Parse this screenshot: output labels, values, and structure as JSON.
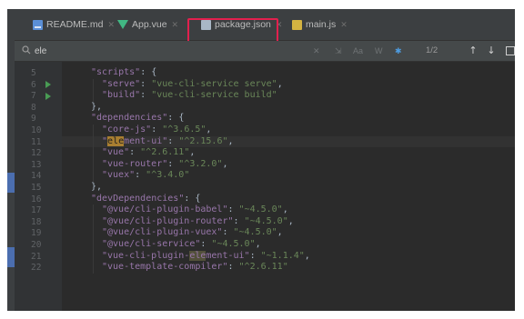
{
  "tabs": [
    {
      "label": "README.md",
      "icon": "markdown-file-icon"
    },
    {
      "label": "App.vue",
      "icon": "vue-file-icon"
    },
    {
      "label": "package.json",
      "icon": "json-file-icon",
      "active": true,
      "highlighted": true
    },
    {
      "label": "main.js",
      "icon": "js-file-icon"
    }
  ],
  "search": {
    "query": "ele",
    "match_count": "1/2"
  },
  "colors": {
    "key": "#9876aa",
    "string": "#6a8759",
    "punct": "#a9b7c6",
    "match_highlight": "#a97f31",
    "tab_highlight_frame": "#e2204e"
  },
  "editor": {
    "lines": [
      {
        "num": "5",
        "k": "\"scripts\"",
        "rest": ": {"
      },
      {
        "num": "6",
        "k": "\"serve\"",
        "sep": ": ",
        "v": "\"vue-cli-service serve\"",
        "end": ",",
        "run": true
      },
      {
        "num": "7",
        "k": "\"build\"",
        "sep": ": ",
        "v": "\"vue-cli-service build\"",
        "run": true
      },
      {
        "num": "8",
        "rest": "},"
      },
      {
        "num": "9",
        "k": "\"dependencies\"",
        "rest": ": {"
      },
      {
        "num": "10",
        "k": "\"core-js\"",
        "sep": ": ",
        "v": "\"^3.6.5\"",
        "end": ","
      },
      {
        "num": "11",
        "k_pre": "\"",
        "k_match": "ele",
        "k_post": "ment-ui\"",
        "sep": ": ",
        "v": "\"^2.15.6\"",
        "end": ","
      },
      {
        "num": "12",
        "k": "\"vue\"",
        "sep": ": ",
        "v": "\"^2.6.11\"",
        "end": ","
      },
      {
        "num": "13",
        "k": "\"vue-router\"",
        "sep": ": ",
        "v": "\"^3.2.0\"",
        "end": ","
      },
      {
        "num": "14",
        "k": "\"vuex\"",
        "sep": ": ",
        "v": "\"^3.4.0\""
      },
      {
        "num": "15",
        "rest": "},"
      },
      {
        "num": "16",
        "k": "\"devDependencies\"",
        "rest": ": {"
      },
      {
        "num": "17",
        "k": "\"@vue/cli-plugin-babel\"",
        "sep": ": ",
        "v": "\"~4.5.0\"",
        "end": ","
      },
      {
        "num": "18",
        "k": "\"@vue/cli-plugin-router\"",
        "sep": ": ",
        "v": "\"~4.5.0\"",
        "end": ","
      },
      {
        "num": "19",
        "k": "\"@vue/cli-plugin-vuex\"",
        "sep": ": ",
        "v": "\"~4.5.0\"",
        "end": ","
      },
      {
        "num": "20",
        "k": "\"@vue/cli-service\"",
        "sep": ": ",
        "v": "\"~4.5.0\"",
        "end": ","
      },
      {
        "num": "21",
        "k_pre": "\"vue-cli-plugin-",
        "k_match": "ele",
        "k_post": "ment-ui\"",
        "sep": ": ",
        "v": "\"~1.1.4\"",
        "end": ",",
        "match_secondary": true
      },
      {
        "num": "22",
        "k": "\"vue-template-compiler\"",
        "sep": ": ",
        "v": "\"^2.6.11\""
      }
    ]
  }
}
